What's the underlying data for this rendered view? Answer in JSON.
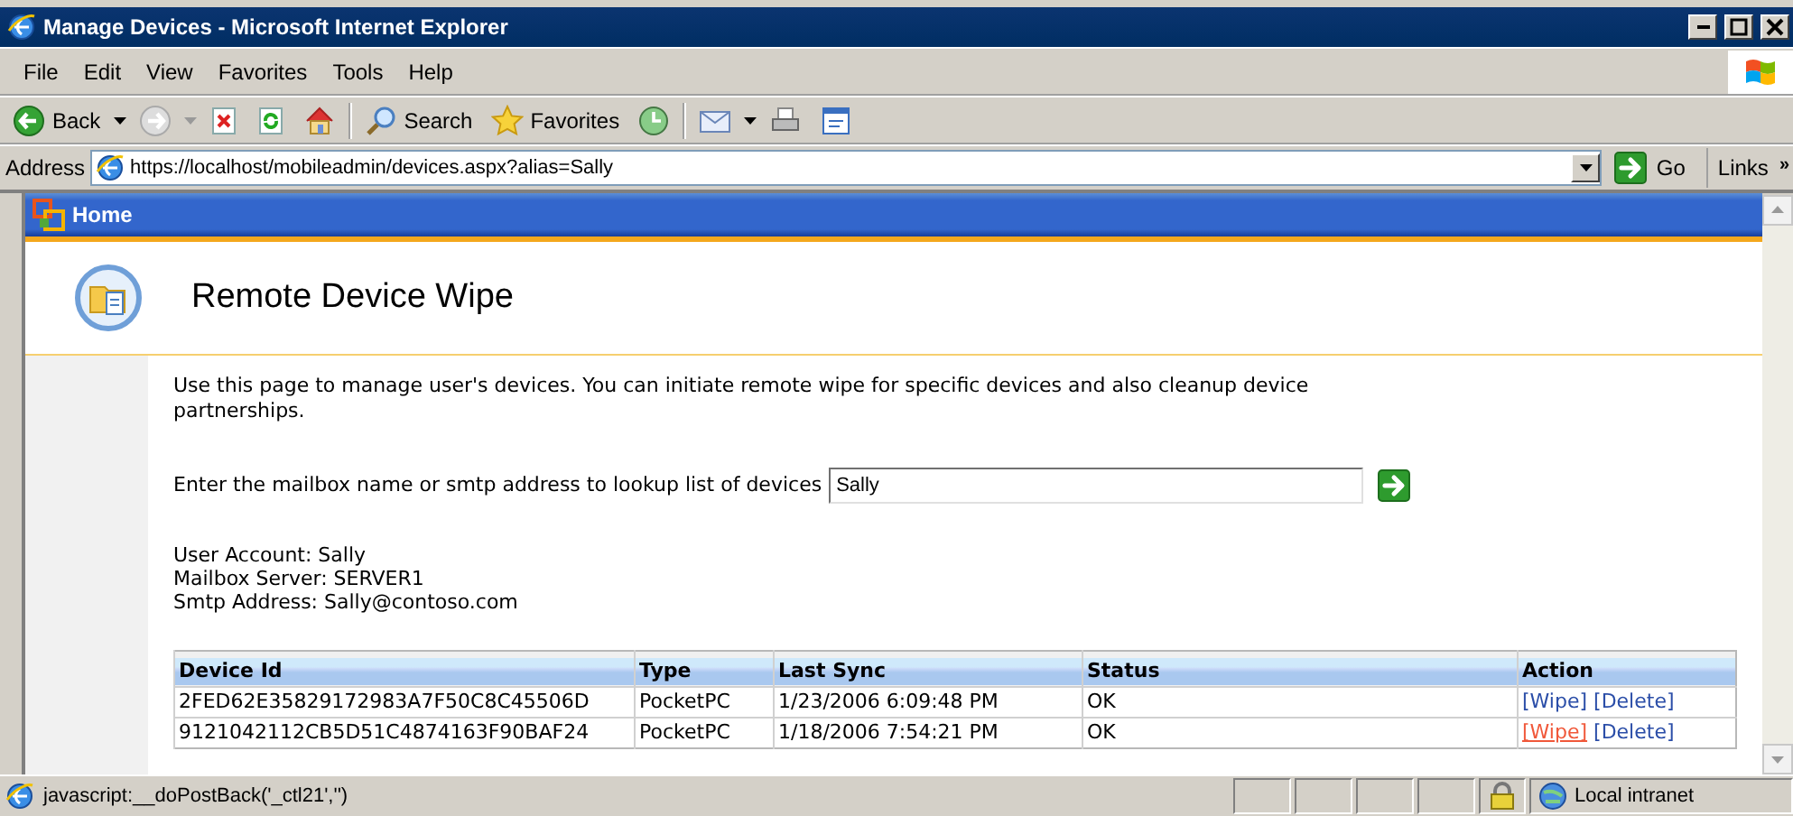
{
  "window": {
    "title": "Manage Devices - Microsoft Internet Explorer"
  },
  "menu": [
    "File",
    "Edit",
    "View",
    "Favorites",
    "Tools",
    "Help"
  ],
  "toolbar": {
    "back": "Back",
    "search": "Search",
    "favorites": "Favorites"
  },
  "address": {
    "label": "Address",
    "url": "https://localhost/mobileadmin/devices.aspx?alias=Sally",
    "go": "Go",
    "links": "Links",
    "more": "»"
  },
  "home_bar": {
    "label": "Home"
  },
  "page": {
    "title": "Remote Device Wipe",
    "intro": "Use this page to manage user's devices. You can initiate remote wipe for specific devices and also cleanup device partnerships.",
    "lookup": {
      "label": "Enter the mailbox name or smtp address to lookup list of devices",
      "value": "Sally"
    },
    "account": [
      "User Account: Sally",
      "Mailbox Server: SERVER1",
      "Smtp Address: Sally@contoso.com"
    ]
  },
  "table": {
    "columns": [
      "Device Id",
      "Type",
      "Last Sync",
      "Status",
      "Action"
    ],
    "rows": [
      {
        "device_id": "2FED62E35829172983A7F50C8C45506D",
        "type": "PocketPC",
        "last_sync": "1/23/2006 6:09:48 PM",
        "status": "OK",
        "actions": [
          {
            "label": "[Wipe]",
            "hovered": false
          },
          {
            "label": "[Delete]",
            "hovered": false
          }
        ]
      },
      {
        "device_id": "9121042112CB5D51C4874163F90BAF24",
        "type": "PocketPC",
        "last_sync": "1/18/2006 7:54:21 PM",
        "status": "OK",
        "actions": [
          {
            "label": "[Wipe]",
            "hovered": true
          },
          {
            "label": "[Delete]",
            "hovered": false
          }
        ]
      }
    ]
  },
  "status_bar": {
    "text": "javascript:__doPostBack('_ctl21','')",
    "zone": "Local intranet"
  }
}
